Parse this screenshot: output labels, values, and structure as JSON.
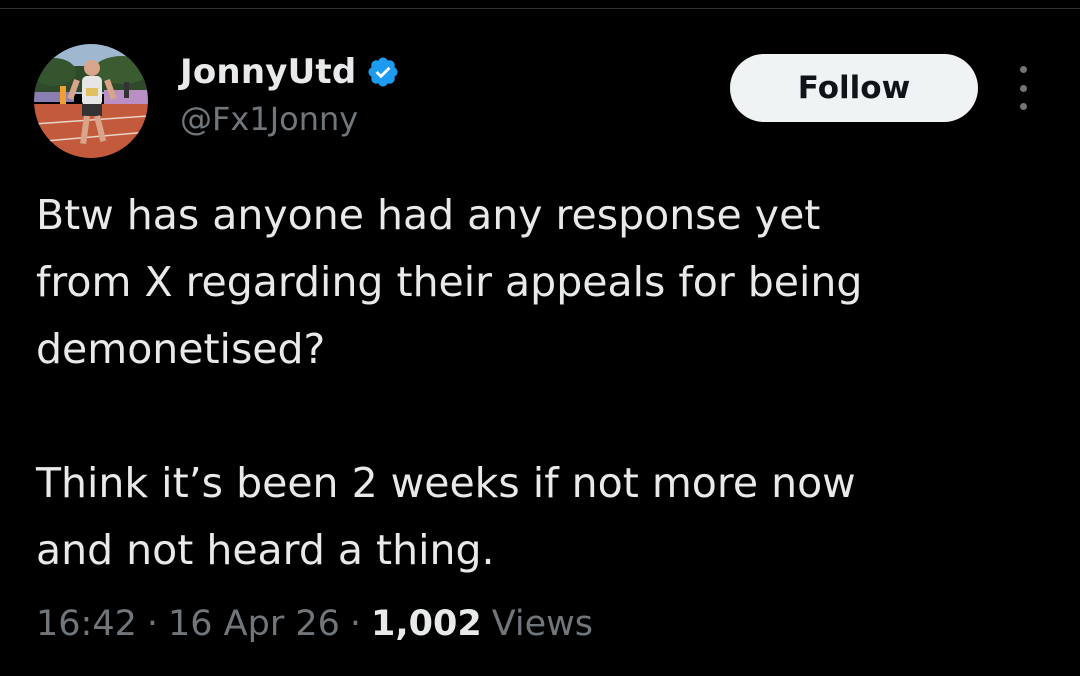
{
  "author": {
    "display_name": "JonnyUtd",
    "handle": "@Fx1Jonny",
    "verified": true,
    "avatar_icon": "profile-photo-runner"
  },
  "actions": {
    "follow_label": "Follow",
    "more_icon": "more-options-icon"
  },
  "tweet": {
    "paragraphs": [
      "Btw has anyone had any response yet\nfrom X regarding their appeals for being\ndemonetised?",
      "Think it’s been 2 weeks if not more now\nand not heard a thing."
    ]
  },
  "meta": {
    "time": "16:42",
    "date": "16 Apr 26",
    "separator": "·",
    "views_count": "1,002",
    "views_label": "Views"
  },
  "colors": {
    "background": "#000000",
    "text_primary": "#e7e9ea",
    "text_secondary": "#71767b",
    "verified_badge": "#1d9bf0",
    "follow_button_bg": "#eff3f4",
    "follow_button_text": "#0f1419"
  }
}
